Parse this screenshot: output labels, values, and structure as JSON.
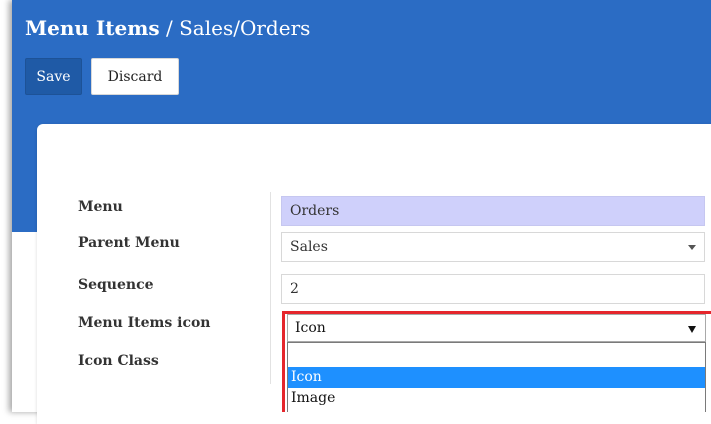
{
  "header": {
    "breadcrumb_root": "Menu Items",
    "breadcrumb_separator": " / ",
    "breadcrumb_current": "Sales/Orders"
  },
  "toolbar": {
    "save_label": "Save",
    "discard_label": "Discard"
  },
  "form": {
    "menu": {
      "label": "Menu",
      "value": "Orders"
    },
    "parent_menu": {
      "label": "Parent Menu",
      "value": "Sales"
    },
    "sequence": {
      "label": "Sequence",
      "value": "2"
    },
    "menu_items_icon": {
      "label": "Menu Items icon",
      "value": "Icon",
      "options": [
        "",
        "Icon",
        "Image"
      ],
      "selected_option": "Icon"
    },
    "icon_class": {
      "label": "Icon Class"
    }
  },
  "colors": {
    "header_bg": "#2b6cc4",
    "save_button_bg": "#1f5aa6",
    "required_field_bg": "#cfd0fb",
    "highlight_border": "#e5262c",
    "selected_option_bg": "#1e90ff"
  }
}
